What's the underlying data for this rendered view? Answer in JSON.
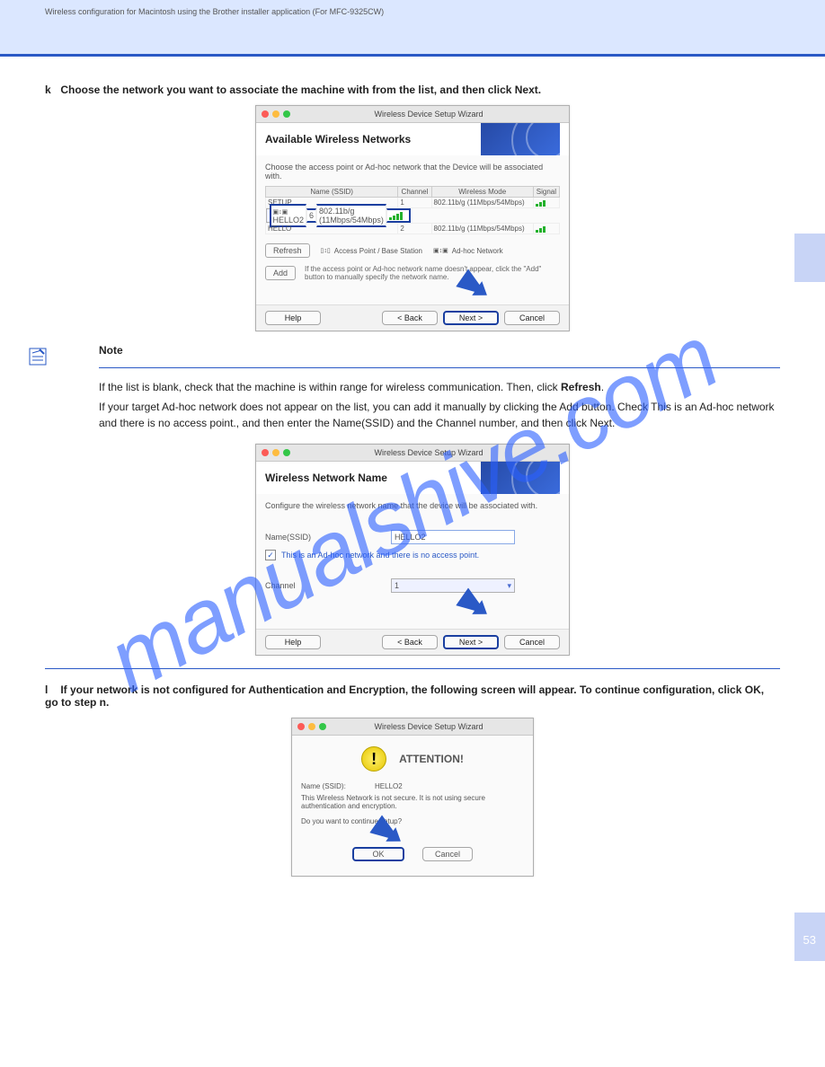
{
  "header": {
    "running": "Wireless configuration for Macintosh using the Brother installer application (For MFC-9325CW)"
  },
  "step_k": {
    "n": "k",
    "text": "Choose the network you want to associate the machine with from the list, and then click Next."
  },
  "dlg1": {
    "title": "Wireless Device Setup Wizard",
    "heading": "Available Wireless Networks",
    "instr": "Choose the access point or Ad-hoc network that the Device will be associated with.",
    "cols": {
      "name": "Name (SSID)",
      "channel": "Channel",
      "mode": "Wireless Mode",
      "signal": "Signal"
    },
    "rows": [
      {
        "name": "SETUP",
        "channel": "1",
        "mode": "802.11b/g (11Mbps/54Mbps)",
        "sel": false
      },
      {
        "name": "HELLO2",
        "channel": "6",
        "mode": "802.11b/g (11Mbps/54Mbps)",
        "sel": true
      },
      {
        "name": "HELLO",
        "channel": "2",
        "mode": "802.11b/g (11Mbps/54Mbps)",
        "sel": false
      }
    ],
    "refresh": "Refresh",
    "legend_ap": "Access Point / Base Station",
    "legend_adhoc": "Ad-hoc Network",
    "add_btn": "Add",
    "add_txt": "If the access point or Ad-hoc network name doesn't appear, click the \"Add\" button to manually specify the network name.",
    "help": "Help",
    "back": "< Back",
    "next": "Next >",
    "cancel": "Cancel"
  },
  "note": {
    "title": "Note",
    "text1": "If the list is blank, check that the machine is within range for wireless communication. Then, click ",
    "refresh": "Refresh",
    "text2": "If your target Ad-hoc network does not appear on the list, you can add it manually by clicking the Add button. Check This is an Ad-hoc network and there is no access point., and then enter the Name(SSID) and the Channel number, and then click Next."
  },
  "dlg2": {
    "title": "Wireless Device Setup Wizard",
    "heading": "Wireless Network Name",
    "instr": "Configure the wireless network name that the device will be associated with.",
    "name_lbl": "Name(SSID)",
    "name_val": "HELLO2",
    "adhoc": "This is an Ad-hoc network and there is no access point.",
    "channel_lbl": "Channel",
    "channel_val": "1",
    "help": "Help",
    "back": "< Back",
    "next": "Next >",
    "cancel": "Cancel"
  },
  "step_l": {
    "n": "l",
    "text1": "If your network is not configured for Authentication and Encryption, the following screen will appear. To continue configuration, click ",
    "ok": "OK",
    "text2": ", go to step n."
  },
  "dlg3": {
    "title": "Wireless Device Setup Wizard",
    "heading": "ATTENTION!",
    "name_lbl": "Name (SSID):",
    "name_val": "HELLO2",
    "msg": "This Wireless Network is not secure. It is not using secure authentication and encryption.",
    "q": "Do you want to continue setup?",
    "ok": "OK",
    "cancel": "Cancel"
  },
  "pagenum": "53"
}
